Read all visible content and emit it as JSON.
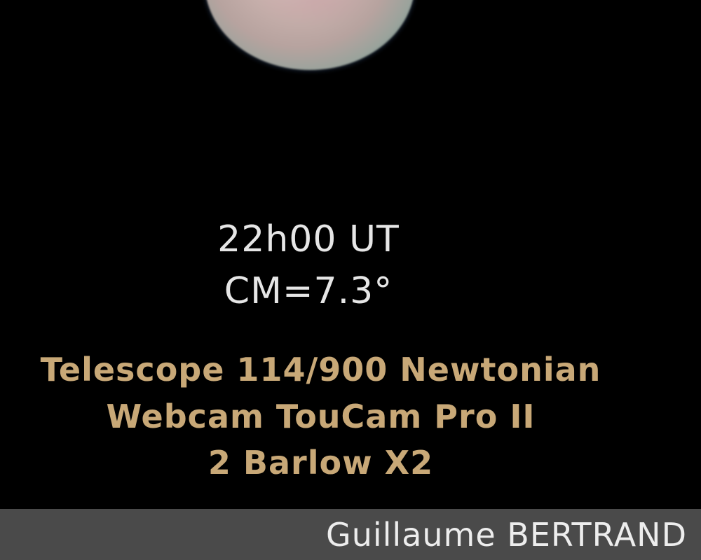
{
  "observation": {
    "time": "22h00 UT",
    "central_meridian": "CM=7.3°"
  },
  "equipment": {
    "telescope": "Telescope 114/900 Newtonian",
    "camera": "Webcam TouCam Pro II",
    "barlow": "2 Barlow X2"
  },
  "credit": {
    "author": "Guillaume BERTRAND"
  },
  "colors": {
    "background": "#000000",
    "observation_text": "#e6e6e6",
    "equipment_text": "#c8a877",
    "footer_bar": "#4a4a4a",
    "credit_text": "#ededed"
  }
}
